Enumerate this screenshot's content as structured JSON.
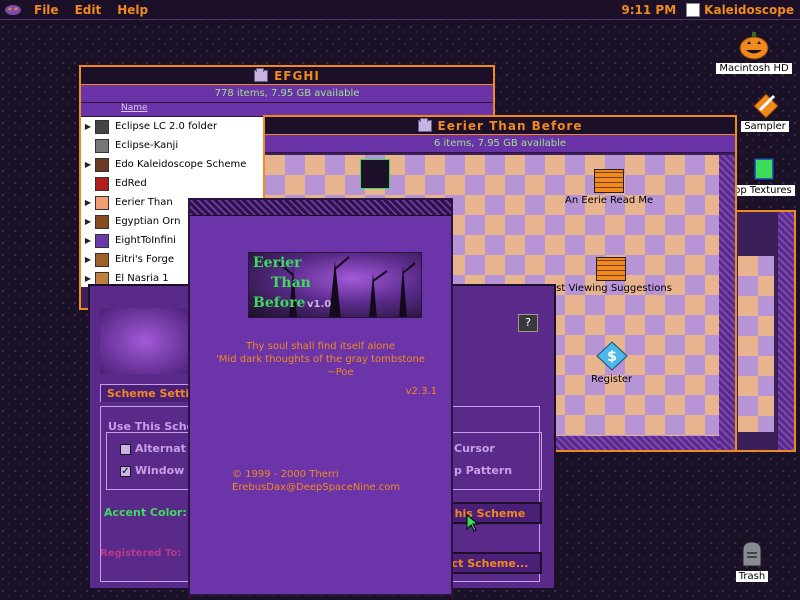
{
  "menubar": {
    "menus": [
      "File",
      "Edit",
      "Help"
    ],
    "clock": "9:11 PM",
    "app_name": "Kaleidoscope"
  },
  "desktop": {
    "icons": [
      {
        "label": "Macintosh HD",
        "icon": "pumpkin-icon"
      },
      {
        "label": "Sampler",
        "icon": "pencil-icon"
      },
      {
        "label": "op Textures",
        "icon": "book-icon"
      },
      {
        "label": "Trash",
        "icon": "tombstone-icon"
      }
    ]
  },
  "efghi": {
    "title": "EFGHI",
    "info": "778 items, 7.95 GB available",
    "column": "Name",
    "items": [
      "Eclipse LC 2.0 folder",
      "Eclipse-Kanji",
      "Edo Kaleidoscope Scheme",
      "EdRed",
      "Eerier Than",
      "Egyptian Orn",
      "EightToInfini",
      "Eitri's Forge",
      "El Nasria 1"
    ]
  },
  "eerier": {
    "title": "Eerier Than Before",
    "info": "6 items, 7.95 GB available",
    "files": [
      {
        "label": "An Eerie Read Me",
        "icon": "readme-doc-icon"
      },
      {
        "label": "est Viewing Suggestions",
        "icon": "readme-doc-icon"
      },
      {
        "label": "Register",
        "icon": "register-dollar-icon"
      }
    ]
  },
  "panel": {
    "tab": "Scheme Setti",
    "group_title": "Use This Sche",
    "opt1": "Alternat",
    "opt2": "Window",
    "opt3": "Cursor",
    "opt4": "p Pattern",
    "accent_label": "Accent Color:",
    "use_button": "his Scheme",
    "select_button": "ct Scheme...",
    "registered_label": "Registered To:"
  },
  "about": {
    "logo_line1": "Eerier",
    "logo_line2": "Than",
    "logo_line3": "Before",
    "logo_version": "v1.0",
    "quote_line1": "Thy soul shall find itself alone",
    "quote_line2": "'Mid dark thoughts of the gray tombstone",
    "quote_line3": "~Poe",
    "version": "v2.3.1",
    "copyright": "© 1999 - 2000 Therri",
    "email": "ErebusDax@DeepSpaceNine.com"
  }
}
